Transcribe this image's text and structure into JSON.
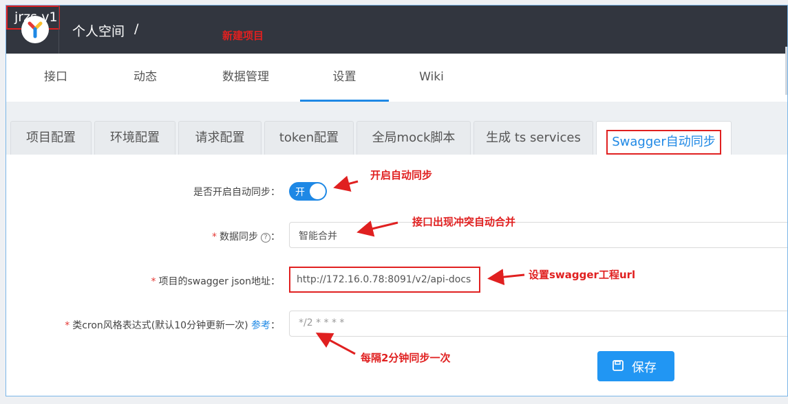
{
  "header": {
    "space": "个人空间",
    "separator": "/",
    "project": "jrzs-v1"
  },
  "nav": {
    "items": [
      "接口",
      "动态",
      "数据管理",
      "设置",
      "Wiki"
    ],
    "active": "设置"
  },
  "tabs": {
    "items": [
      "项目配置",
      "环境配置",
      "请求配置",
      "token配置",
      "全局mock脚本",
      "生成 ts services",
      "Swagger自动同步"
    ],
    "active": "Swagger自动同步"
  },
  "form": {
    "sync_label": "是否开启自动同步：",
    "toggle_text": "开",
    "toggle_on": true,
    "data_sync_label": "数据同步",
    "data_sync_value": "智能合并",
    "url_label": "项目的swagger json地址：",
    "url_value": "http://172.16.0.78:8091/v2/api-docs",
    "cron_label": "类cron风格表达式(默认10分钟更新一次)",
    "cron_ref": "参考",
    "cron_colon": "：",
    "cron_value": "*/2 * * * *",
    "required_mark": "*",
    "colon": "：",
    "save_label": "保存"
  },
  "annotations": {
    "new_project": "新建项目",
    "enable_sync": "开启自动同步",
    "auto_merge": "接口出现冲突自动合并",
    "set_url": "设置swagger工程url",
    "every_2min": "每隔2分钟同步一次"
  },
  "colors": {
    "accent": "#1e88e5",
    "header_bg": "#32363f",
    "annotation": "#e02020",
    "required": "#e53935"
  }
}
